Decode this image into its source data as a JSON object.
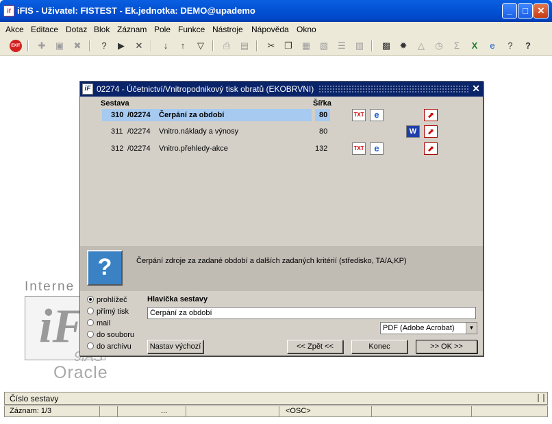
{
  "window": {
    "title": "iFIS - Uživatel: FISTEST - Ek.jednotka: DEMO@upademo"
  },
  "menu": [
    "Akce",
    "Editace",
    "Dotaz",
    "Blok",
    "Záznam",
    "Pole",
    "Funkce",
    "Nástroje",
    "Nápověda",
    "Okno"
  ],
  "watermark": {
    "internet": "Interne",
    "logo": "iF",
    "product": "9iAS",
    "oracle": "Oracle"
  },
  "dialog": {
    "title": "02274 - Účetnictví/Vnitropodnikový tisk obratů (EKOBRVNI)",
    "col_sestava": "Sestava",
    "col_sirka": "Šířka",
    "rows": [
      {
        "num": "310",
        "code": "/02274",
        "name": "Čerpání za období",
        "width": "80"
      },
      {
        "num": "311",
        "code": "/02274",
        "name": "Vnitro.náklady a výnosy",
        "width": "80"
      },
      {
        "num": "312",
        "code": "/02274",
        "name": "Vnitro.přehledy-akce",
        "width": "132"
      }
    ],
    "description": "Čerpání zdroje za zadané období a dalších zadaných kritérií (středisko, TA/A,KP)",
    "output_options": [
      "prohlížeč",
      "přímý tisk",
      "mail",
      "do souboru",
      "do archivu"
    ],
    "header_label": "Hlavička sestavy",
    "header_value": "Čerpání za období",
    "format_value": "PDF (Adobe Acrobat)",
    "buttons": {
      "defaults": "Nastav výchozí",
      "back": "<< Zpět <<",
      "end": "Konec",
      "ok": ">> OK >>"
    }
  },
  "status": {
    "line1": "Číslo sestavy",
    "record": "Záznam: 1/3",
    "ellipsis": "...",
    "mode": "<OSC>"
  }
}
